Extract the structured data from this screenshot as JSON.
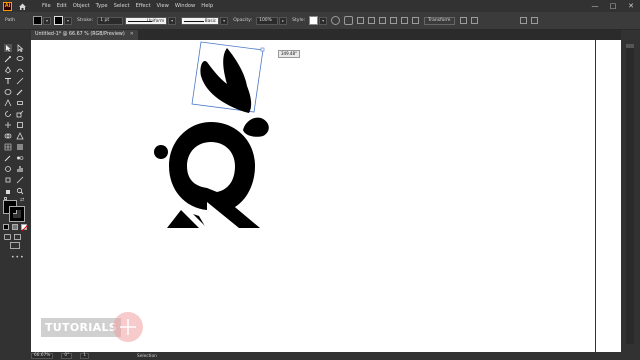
{
  "menu": {
    "app_logo": "Ai",
    "items": [
      "File",
      "Edit",
      "Object",
      "Type",
      "Select",
      "Effect",
      "View",
      "Window",
      "Help"
    ],
    "window_controls": [
      "—",
      "□",
      "✕"
    ]
  },
  "control_bar": {
    "selection_label": "Path",
    "stroke_label": "Stroke:",
    "stroke_weight": "1 pt",
    "profile_label": "Uniform",
    "brush_label": "Basic",
    "opacity_label": "Opacity:",
    "opacity_value": "100%",
    "style_label": "Style:",
    "transform_label": "Transform"
  },
  "document": {
    "tab_title": "Untitled-1* @ 66.67 % (RGB/Preview)",
    "close": "✕"
  },
  "canvas": {
    "rotate_tooltip": "349.48°",
    "colors": {
      "shape_fill": "#000000",
      "selection_box": "#4a76c8"
    }
  },
  "watermark": {
    "text": "TUTORIALS"
  },
  "status_bar": {
    "zoom": "66.67%",
    "rotation": "0°",
    "artboard": "1",
    "tool_name": "Selection"
  }
}
